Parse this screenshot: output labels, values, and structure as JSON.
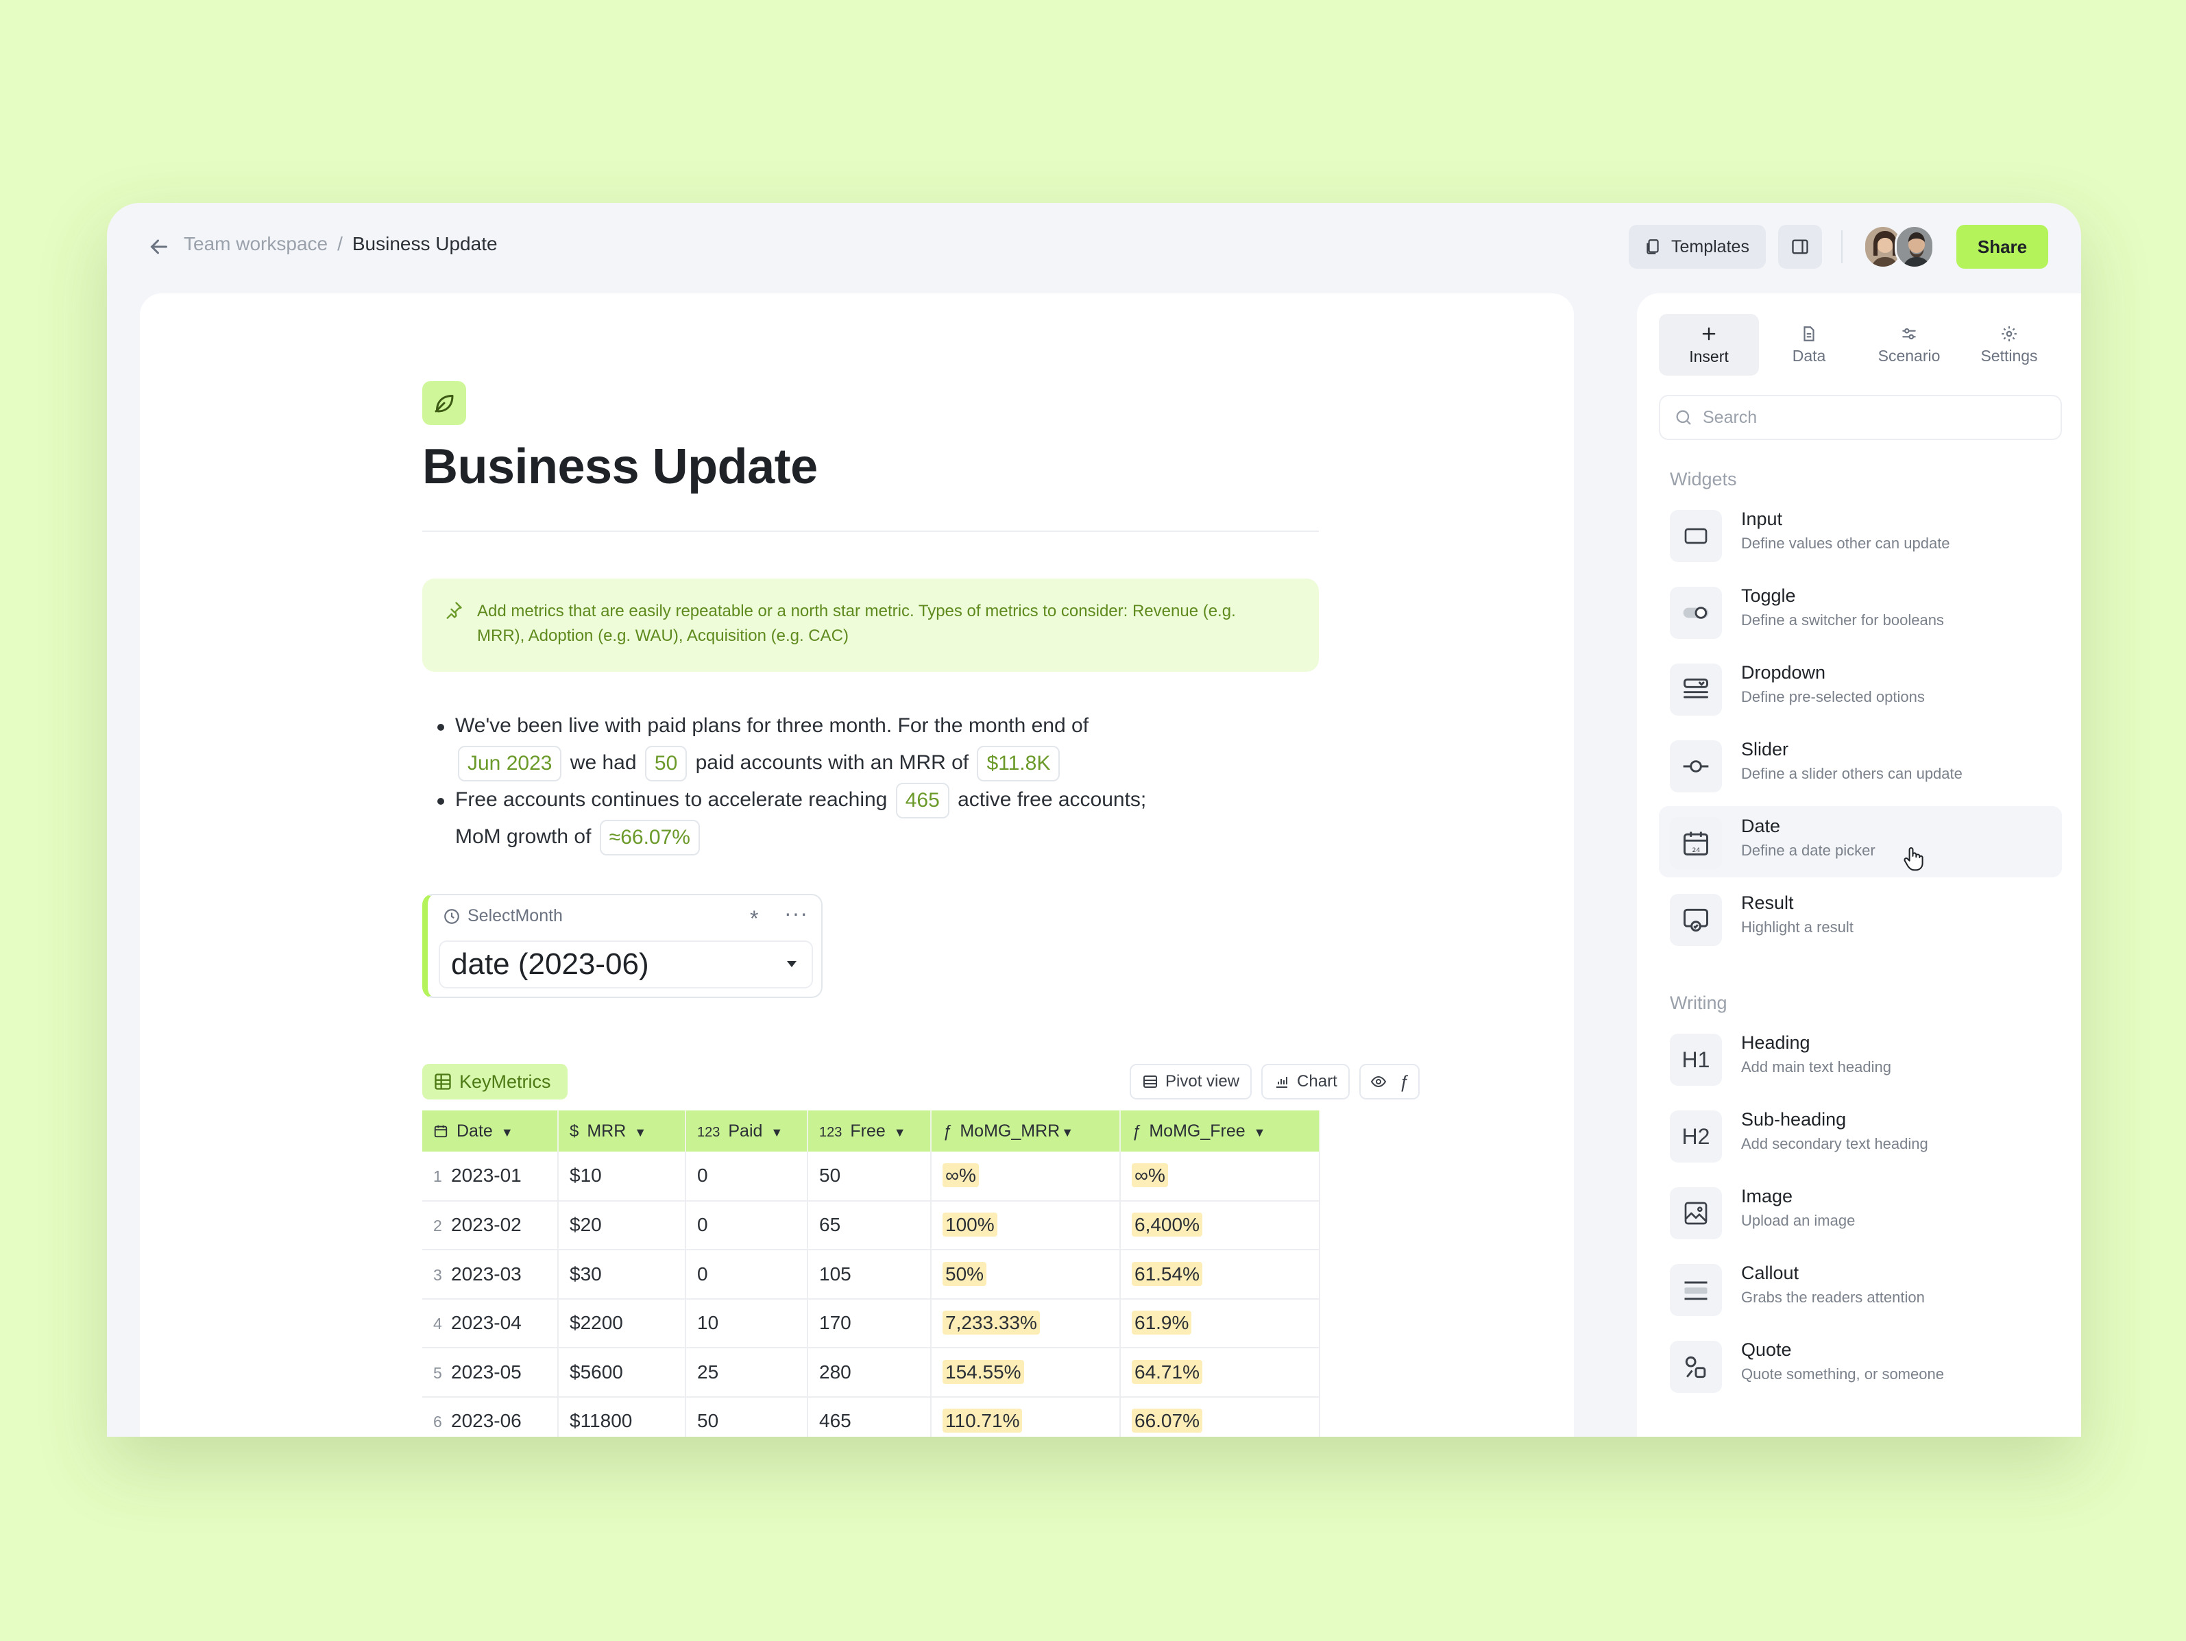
{
  "breadcrumb": {
    "parent": "Team workspace",
    "separator": "/",
    "current": "Business Update"
  },
  "header": {
    "templates_label": "Templates",
    "share_label": "Share"
  },
  "doc": {
    "title": "Business Update",
    "callout": "Add metrics that are easily repeatable or a north star metric. Types of metrics to consider: Revenue (e.g. MRR), Adoption (e.g. WAU), Acquisition (e.g. CAC)",
    "bullet1": {
      "a": "We've been live with paid plans for three month. For the month end of",
      "chip_month": "Jun 2023",
      "b": "we had",
      "chip_paid": "50",
      "c": "paid accounts with an MRR of",
      "chip_mrr": "$11.8K"
    },
    "bullet2": {
      "a": "Free accounts continues to accelerate reaching",
      "chip_free": "465",
      "b": "active free accounts;",
      "c": "MoM growth of",
      "chip_growth": "≈66.07%"
    }
  },
  "select_widget": {
    "label": "SelectMonth",
    "value": "date (2023-06)"
  },
  "table": {
    "name": "KeyMetrics",
    "tools": {
      "pivot": "Pivot view",
      "chart": "Chart"
    },
    "columns": [
      {
        "icon": "calendar-icon",
        "label": "Date"
      },
      {
        "icon": "$",
        "label": "MRR"
      },
      {
        "icon": "123",
        "label": "Paid"
      },
      {
        "icon": "123",
        "label": "Free"
      },
      {
        "icon": "ƒ",
        "label": "MoMG_MRR"
      },
      {
        "icon": "ƒ",
        "label": "MoMG_Free"
      }
    ],
    "rows": [
      {
        "n": "1",
        "date": "2023-01",
        "mrr": "$10",
        "paid": "0",
        "free": "50",
        "momg_mrr": "∞%",
        "momg_free": "∞%"
      },
      {
        "n": "2",
        "date": "2023-02",
        "mrr": "$20",
        "paid": "0",
        "free": "65",
        "momg_mrr": "100%",
        "momg_free": "6,400%"
      },
      {
        "n": "3",
        "date": "2023-03",
        "mrr": "$30",
        "paid": "0",
        "free": "105",
        "momg_mrr": "50%",
        "momg_free": "61.54%"
      },
      {
        "n": "4",
        "date": "2023-04",
        "mrr": "$2200",
        "paid": "10",
        "free": "170",
        "momg_mrr": "7,233.33%",
        "momg_free": "61.9%"
      },
      {
        "n": "5",
        "date": "2023-05",
        "mrr": "$5600",
        "paid": "25",
        "free": "280",
        "momg_mrr": "154.55%",
        "momg_free": "64.71%"
      },
      {
        "n": "6",
        "date": "2023-06",
        "mrr": "$11800",
        "paid": "50",
        "free": "465",
        "momg_mrr": "110.71%",
        "momg_free": "66.07%"
      }
    ]
  },
  "panel": {
    "tabs": [
      "Insert",
      "Data",
      "Scenario",
      "Settings"
    ],
    "search_placeholder": "Search",
    "widgets_label": "Widgets",
    "writing_label": "Writing",
    "widgets": [
      {
        "name": "Input",
        "desc": "Define values other can update"
      },
      {
        "name": "Toggle",
        "desc": "Define a switcher for booleans"
      },
      {
        "name": "Dropdown",
        "desc": "Define pre-selected options"
      },
      {
        "name": "Slider",
        "desc": "Define a slider others can update"
      },
      {
        "name": "Date",
        "desc": "Define a date picker"
      },
      {
        "name": "Result",
        "desc": "Highlight a result"
      }
    ],
    "writing": [
      {
        "name": "Heading",
        "desc": "Add main text heading",
        "glyph": "H1"
      },
      {
        "name": "Sub-heading",
        "desc": "Add secondary text heading",
        "glyph": "H2"
      },
      {
        "name": "Image",
        "desc": "Upload an image"
      },
      {
        "name": "Callout",
        "desc": "Grabs the readers attention"
      },
      {
        "name": "Quote",
        "desc": "Quote something, or someone"
      }
    ]
  },
  "colors": {
    "accent": "#b4f35a",
    "background": "#e5fcc2",
    "header_row": "#c9f293",
    "highlight": "#fdeeb8"
  }
}
